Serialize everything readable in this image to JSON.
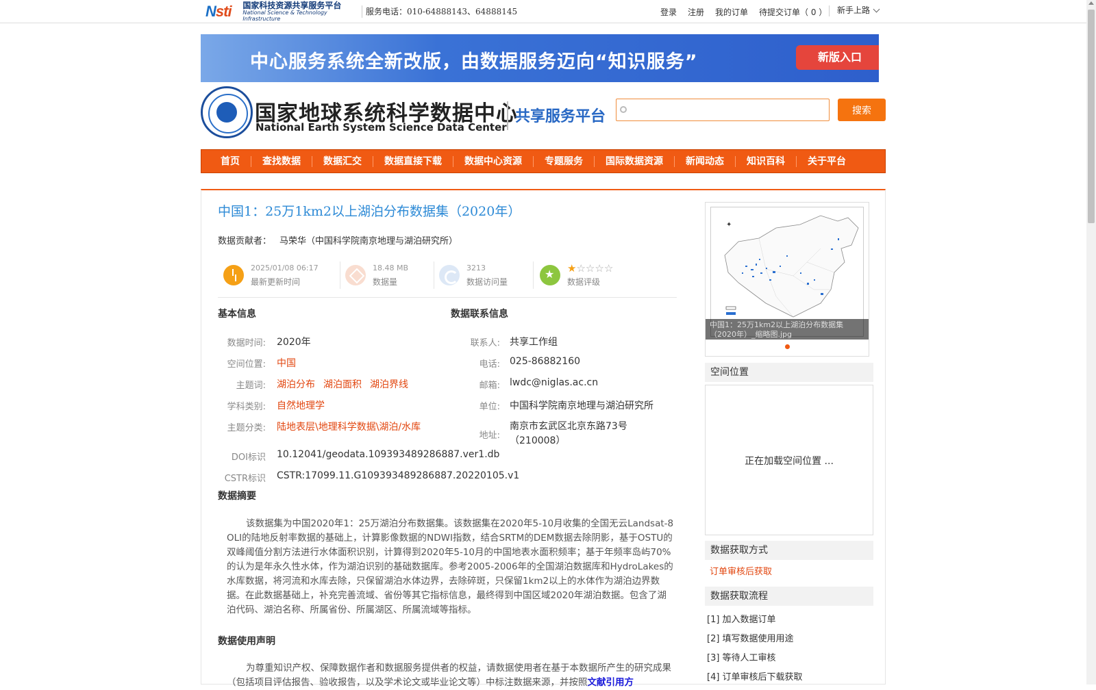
{
  "topbar": {
    "logo_mark": "Nsti",
    "logo_cn": "国家科技资源共享服务平台",
    "logo_en": "National Science & Technology Infrastructure",
    "phone": "服务电话：010-64888143、64888145",
    "links": [
      "登录",
      "注册",
      "我的订单",
      "待提交订单（ 0 ）"
    ],
    "newbie": "新手上路"
  },
  "banner": {
    "text": "中心服务系统全新改版，由数据服务迈向“知识服务”",
    "button": "新版入口"
  },
  "header": {
    "title_cn": "国家地球系统科学数据中心",
    "title_en": "National Earth System Science Data Center",
    "subtitle": "共享服务平台",
    "search_placeholder": "",
    "search_button": "搜索"
  },
  "nav": [
    "首页",
    "查找数据",
    "数据汇交",
    "数据直接下载",
    "数据中心资源",
    "专题服务",
    "国际数据资源",
    "新闻动态",
    "知识百科",
    "关于平台"
  ],
  "dataset": {
    "title": "中国1：25万1km2以上湖泊分布数据集（2020年）",
    "contributor_label": "数据贡献者：",
    "contributor": "马荣华（中国科学院南京地理与湖泊研究所）",
    "stats": {
      "update_time": "2025/01/08 06:17",
      "update_label": "最新更新时间",
      "size": "18.48 MB",
      "size_label": "数据量",
      "visits": "3213",
      "visits_label": "数据访问量",
      "rating": 1,
      "rating_max": 5,
      "rating_label": "数据评级"
    },
    "basic_info_title": "基本信息",
    "basic": {
      "time_label": "数据时间:",
      "time": "2020年",
      "space_label": "空间位置:",
      "space": "中国",
      "keywords_label": "主题词:",
      "keywords": [
        "湖泊分布",
        "湖泊面积",
        "湖泊界线"
      ],
      "discipline_label": "学科类别:",
      "discipline": "自然地理学",
      "category_label": "主题分类:",
      "category": "陆地表层\\地理科学数据\\湖泊/水库",
      "doi_label": "DOI标识",
      "doi": "10.12041/geodata.109393489286887.ver1.db",
      "cstr_label": "CSTR标识",
      "cstr": "CSTR:17099.11.G109393489286887.20220105.v1"
    },
    "contact_title": "数据联系信息",
    "contact": {
      "person_label": "联系人:",
      "person": "共享工作组",
      "phone_label": "电话:",
      "phone": "025-86882160",
      "email_label": "邮箱:",
      "email": "lwdc@niglas.ac.cn",
      "unit_label": "单位:",
      "unit": "中国科学院南京地理与湖泊研究所",
      "address_label": "地址:",
      "address": "南京市玄武区北京东路73号（210008）"
    },
    "abstract_title": "数据摘要",
    "abstract": "该数据集为中国2020年1：25万湖泊分布数据集。该数据集在2020年5-10月收集的全国无云Landsat-8 OLI的陆地反射率数据的基础上，计算影像数据的NDWI指数，结合SRTM的DEM数据去除阴影，基于OSTU的双峰阈值分割方法进行水体面积识别，计算得到2020年5-10月的中国地表水面积频率；基于年频率岛屿70%的认为是年永久性水体，作为湖泊识别的基础数据库。参考2005-2006年的全国湖泊数据库和HydroLakes的水库数据，将河流和水库去除，只保留湖泊水体边界，去除碎斑，只保留1km2以上的水体作为湖泊边界数据。在此数据基础上，补充完善流域、省份等其它指标信息，最终得到中国区域2020年湖泊数据。包含了湖泊代码、湖泊名称、所属省份、所属湖区、所属流域等指标。",
    "usage_title": "数据使用声明",
    "usage": "为尊重知识产权、保障数据作者和数据服务提供者的权益，请数据使用者在基于本数据所产生的研究成果（包括项目评估报告、验收报告，以及学术论文或毕业论文等）中标注数据来源，并按照",
    "usage_link": "文献引用方"
  },
  "sidebar": {
    "thumb_caption": "中国1：25万1km2以上湖泊分布数据集（2020年）_缩略图.jpg",
    "spatial_title": "空间位置",
    "spatial_loading": "正在加载空间位置 ...",
    "access_title": "数据获取方式",
    "access_value": "订单审核后获取",
    "flow_title": "数据获取流程",
    "flow_steps": [
      "[1] 加入数据订单",
      "[2] 填写数据使用用途",
      "[3] 等待人工审核",
      "[4] 订单审核后下载获取"
    ]
  },
  "colors": {
    "accent": "#f05a13",
    "title_blue": "#2d8ad6",
    "link_orange": "#e2460f"
  }
}
